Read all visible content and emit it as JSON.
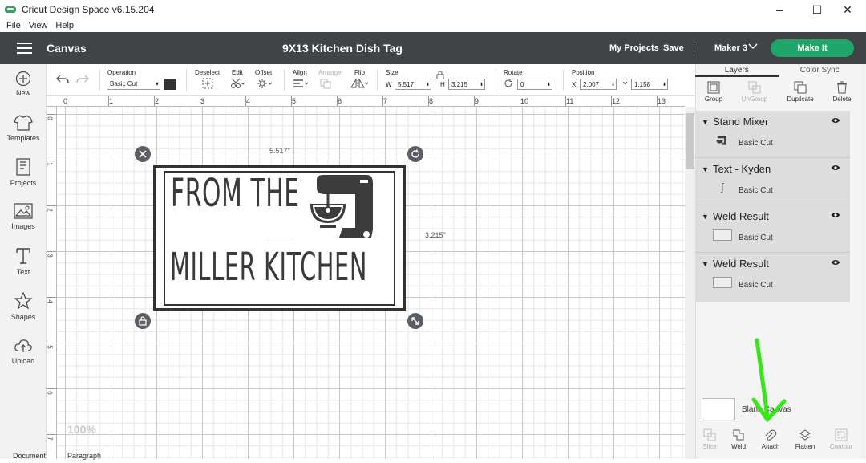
{
  "window": {
    "title": "Cricut Design Space  v6.15.204",
    "controls": [
      "–",
      "☐",
      "✕"
    ]
  },
  "menu": [
    "File",
    "View",
    "Help"
  ],
  "header": {
    "section": "Canvas",
    "project": "9X13 Kitchen Dish Tag",
    "my_projects": "My Projects",
    "save": "Save",
    "separator": "|",
    "machine": "Maker 3",
    "make_it": "Make It",
    "accent": "#1fa56a"
  },
  "sidebar": [
    {
      "label": "New",
      "icon": "plus-circle-icon"
    },
    {
      "label": "Templates",
      "icon": "tshirt-icon"
    },
    {
      "label": "Projects",
      "icon": "projects-icon"
    },
    {
      "label": "Images",
      "icon": "image-icon"
    },
    {
      "label": "Text",
      "icon": "text-icon"
    },
    {
      "label": "Shapes",
      "icon": "shapes-icon"
    },
    {
      "label": "Upload",
      "icon": "upload-icon"
    }
  ],
  "toolbar": {
    "operation_label": "Operation",
    "operation_value": "Basic Cut",
    "deselect": "Deselect",
    "edit": "Edit",
    "offset": "Offset",
    "align": "Align",
    "arrange": "Arrange",
    "flip": "Flip",
    "size_label": "Size",
    "w_label": "W",
    "w_value": "5.517",
    "h_label": "H",
    "h_value": "3.215",
    "rotate_label": "Rotate",
    "rotate_value": "0",
    "position_label": "Position",
    "x_label": "X",
    "x_value": "2.007",
    "y_label": "Y",
    "y_value": "1.158"
  },
  "ruler": {
    "top": [
      "0",
      "1",
      "2",
      "3",
      "4",
      "5",
      "6",
      "7",
      "8",
      "9",
      "10",
      "11",
      "12",
      "13"
    ],
    "left": [
      "0",
      "1",
      "2",
      "3",
      "4",
      "5",
      "6",
      "7"
    ]
  },
  "canvas": {
    "width_dim": "5.517\"",
    "height_dim": "3.215\"",
    "line1": "FROM THE",
    "line2": "MILLER KITCHEN",
    "zoom": "100%"
  },
  "bottom_tabs": [
    "Document",
    "Paragraph"
  ],
  "panel": {
    "tabs": [
      "Layers",
      "Color Sync"
    ],
    "actions": [
      {
        "label": "Group",
        "enabled": true
      },
      {
        "label": "UnGroup",
        "enabled": false
      },
      {
        "label": "Duplicate",
        "enabled": true
      },
      {
        "label": "Delete",
        "enabled": true
      }
    ],
    "layers": [
      {
        "name": "Stand Mixer",
        "sub": "Basic Cut"
      },
      {
        "name": "Text - Kyden",
        "sub": "Basic Cut"
      },
      {
        "name": "Weld Result",
        "sub": "Basic Cut"
      },
      {
        "name": "Weld Result",
        "sub": "Basic Cut"
      }
    ],
    "blank_canvas": "Blank Canvas",
    "bottom_actions": [
      {
        "label": "Slice",
        "enabled": false
      },
      {
        "label": "Weld",
        "enabled": true
      },
      {
        "label": "Attach",
        "enabled": true
      },
      {
        "label": "Flatten",
        "enabled": true
      },
      {
        "label": "Contour",
        "enabled": false
      }
    ]
  },
  "annotation_color": "#39e61a"
}
